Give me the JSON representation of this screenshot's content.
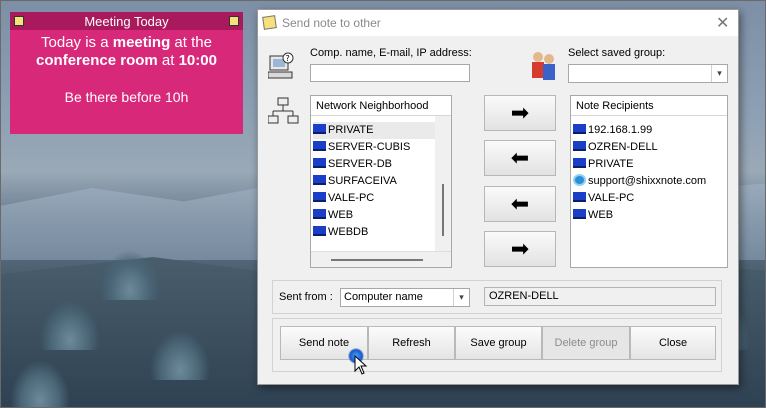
{
  "sticky": {
    "title": "Meeting Today",
    "line1_pre": "Today is a ",
    "line1_bold": "meeting",
    "line1_post": " at the",
    "line2_bold1": "conference room",
    "line2_mid": " at ",
    "line2_bold2": "10:00",
    "line3": "Be there before 10h"
  },
  "dialog": {
    "title": "Send note to other",
    "close_glyph": "✕",
    "address_label": "Comp. name, E-mail, IP address:",
    "address_value": "",
    "group_label": "Select saved group:",
    "group_value": "",
    "network": {
      "header": "Network Neighborhood",
      "items": [
        "PRIVATE",
        "SERVER-CUBIS",
        "SERVER-DB",
        "SURFACEIVA",
        "VALE-PC",
        "WEB",
        "WEBDB"
      ]
    },
    "recipients": {
      "header": "Note Recipients",
      "items": [
        {
          "label": "192.168.1.99",
          "icon": "computer-icon"
        },
        {
          "label": "OZREN-DELL",
          "icon": "computer-icon"
        },
        {
          "label": "PRIVATE",
          "icon": "computer-icon"
        },
        {
          "label": "support@shixxnote.com",
          "icon": "email-icon"
        },
        {
          "label": "VALE-PC",
          "icon": "computer-icon"
        },
        {
          "label": "WEB",
          "icon": "computer-icon"
        }
      ]
    },
    "arrows": [
      "➡",
      "⬅",
      "⬅",
      "➡"
    ],
    "sent_from_label": "Sent from :",
    "sent_from_value": "Computer name",
    "sent_from_name": "OZREN-DELL",
    "buttons": {
      "send": "Send note",
      "refresh": "Refresh",
      "save_group": "Save group",
      "delete_group": "Delete group",
      "close": "Close"
    }
  },
  "colors": {
    "sticky_bg": "#d8287a",
    "sticky_bar": "#a81a5c",
    "dialog_bg": "#f0f0f0"
  }
}
